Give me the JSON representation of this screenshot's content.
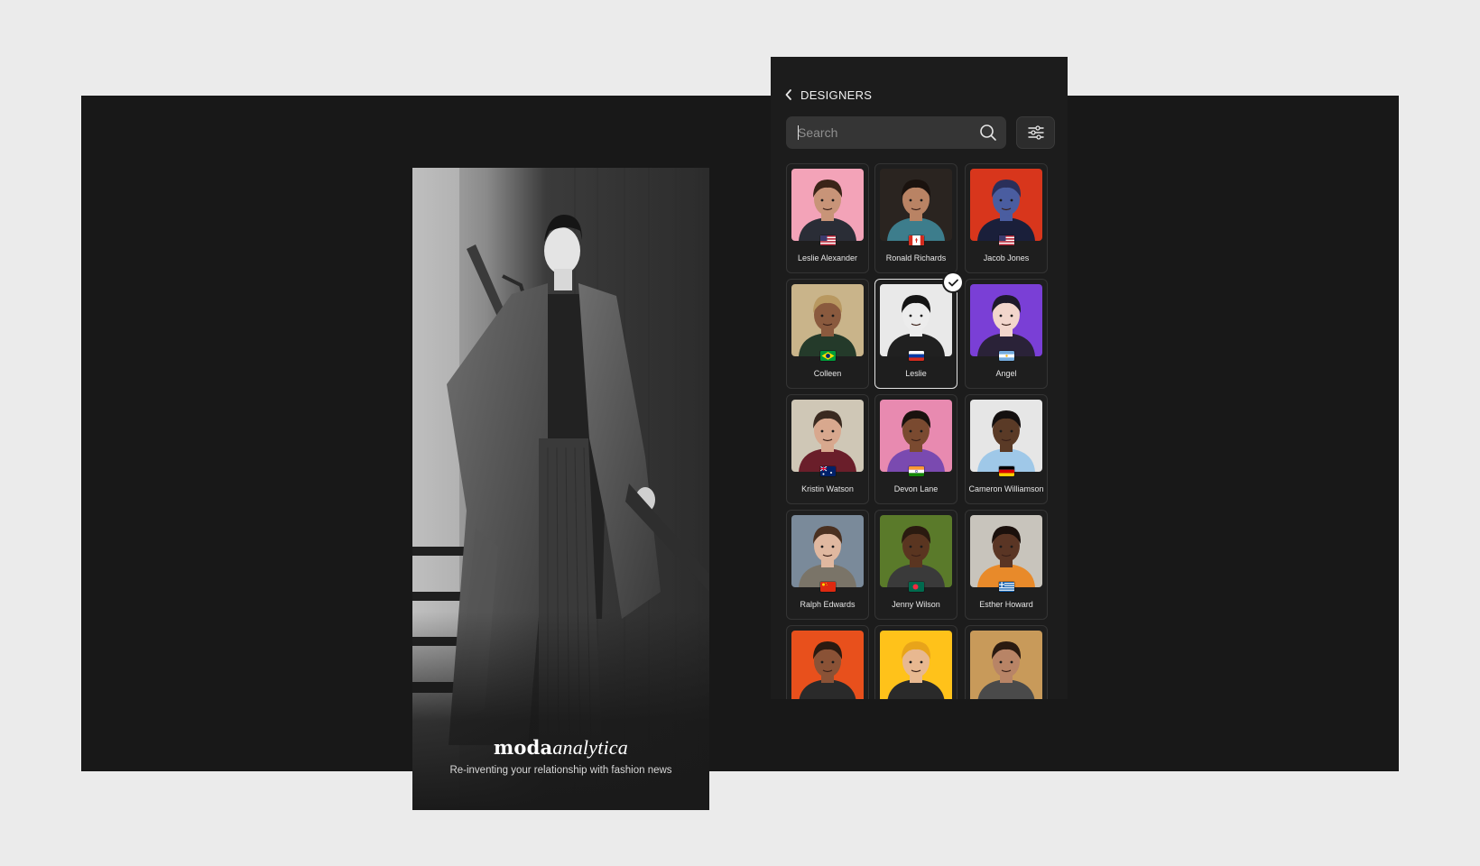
{
  "splash": {
    "brand_bold": "moda",
    "brand_italic": "analytica",
    "tagline": "Re-inventing your relationship with fashion news"
  },
  "panel": {
    "back_icon": "chevron-left-icon",
    "title": "DESIGNERS",
    "search": {
      "placeholder": "Search",
      "value": ""
    },
    "search_icon": "search-icon",
    "filter_icon": "sliders-icon"
  },
  "designers": [
    {
      "name": "Leslie Alexander",
      "flag": "us",
      "bg": "#f3a3b8",
      "skin": "#c89478",
      "hair": "#3a2418",
      "shirt": "#2a2d36",
      "selected": false
    },
    {
      "name": "Ronald Richards",
      "flag": "ca",
      "bg": "#2a2420",
      "skin": "#b98364",
      "hair": "#1a120e",
      "shirt": "#3d7d8c",
      "selected": false
    },
    {
      "name": "Jacob Jones",
      "flag": "us",
      "bg": "#d8361c",
      "skin": "#4a5da0",
      "hair": "#2a2f5a",
      "shirt": "#1a1f3a",
      "selected": false
    },
    {
      "name": "Colleen",
      "flag": "br",
      "bg": "#c9b48a",
      "skin": "#8a5a3e",
      "hair": "#b89860",
      "shirt": "#243a2a",
      "selected": false
    },
    {
      "name": "Leslie",
      "flag": "ru",
      "bg": "#e9e9e9",
      "skin": "#ececec",
      "hair": "#141414",
      "shirt": "#202020",
      "selected": true
    },
    {
      "name": "Angel",
      "flag": "ar",
      "bg": "#7a3fd6",
      "skin": "#f2d6cc",
      "hair": "#1e1a2a",
      "shirt": "#2a2238",
      "selected": false
    },
    {
      "name": "Kristin Watson",
      "flag": "au",
      "bg": "#cfc7b6",
      "skin": "#d8a88e",
      "hair": "#3a2a20",
      "shirt": "#6a1e2a",
      "selected": false
    },
    {
      "name": "Devon Lane",
      "flag": "in",
      "bg": "#e88ab0",
      "skin": "#7a4a30",
      "hair": "#1a120e",
      "shirt": "#7a4ab0",
      "selected": false
    },
    {
      "name": "Cameron Williamson",
      "flag": "de",
      "bg": "#e6e6e6",
      "skin": "#5a3a26",
      "hair": "#141010",
      "shirt": "#9fc8e8",
      "selected": false
    },
    {
      "name": "Ralph Edwards",
      "flag": "cn",
      "bg": "#7a8a9a",
      "skin": "#e0b8a0",
      "hair": "#4a3020",
      "shirt": "#7a7468",
      "selected": false
    },
    {
      "name": "Jenny Wilson",
      "flag": "bd",
      "bg": "#5a7a2a",
      "skin": "#5a3520",
      "hair": "#2a1a10",
      "shirt": "#3a3a3a",
      "selected": false
    },
    {
      "name": "Esther Howard",
      "flag": "gr",
      "bg": "#c8c4bc",
      "skin": "#5a3524",
      "hair": "#1a100c",
      "shirt": "#e88a2a",
      "selected": false
    },
    {
      "name": "",
      "flag": "",
      "bg": "#e8501c",
      "skin": "#8a5236",
      "hair": "#2a1a10",
      "shirt": "#2a2a2a",
      "selected": false
    },
    {
      "name": "",
      "flag": "",
      "bg": "#ffc21a",
      "skin": "#e8b890",
      "hair": "#e8a41a",
      "shirt": "#2a2a2a",
      "selected": false
    },
    {
      "name": "",
      "flag": "",
      "bg": "#c89a5a",
      "skin": "#b88466",
      "hair": "#2a1a10",
      "shirt": "#4a4a4a",
      "selected": false
    }
  ]
}
